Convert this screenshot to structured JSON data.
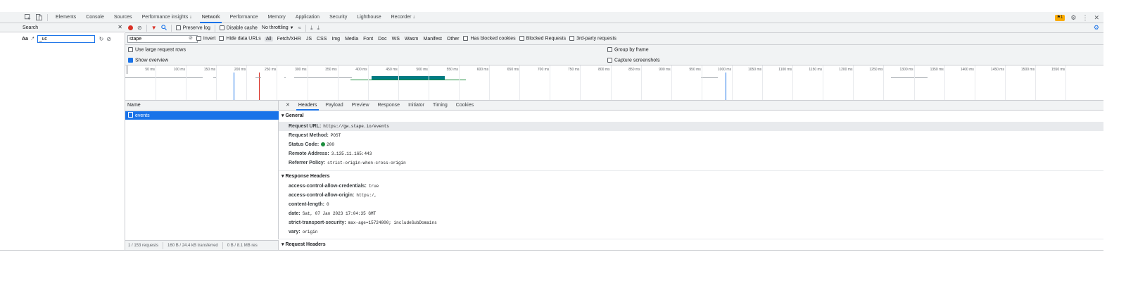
{
  "topbar": {
    "tabs": [
      "Elements",
      "Console",
      "Sources",
      "Performance insights ↓",
      "Network",
      "Performance",
      "Memory",
      "Application",
      "Security",
      "Lighthouse",
      "Recorder ↓"
    ],
    "active_tab": "Network",
    "issues_count": "1"
  },
  "search": {
    "title": "Search",
    "case_label": "Aa",
    "regex_label": ".*",
    "query": "_uc"
  },
  "toolbar": {
    "preserve_log": "Preserve log",
    "disable_cache": "Disable cache",
    "throttling": "No throttling"
  },
  "filter": {
    "value": "stape",
    "invert": "Invert",
    "hide_data_urls": "Hide data URLs",
    "types": [
      "All",
      "Fetch/XHR",
      "JS",
      "CSS",
      "Img",
      "Media",
      "Font",
      "Doc",
      "WS",
      "Wasm",
      "Manifest",
      "Other"
    ],
    "active_type": "All",
    "has_blocked_cookies": "Has blocked cookies",
    "blocked_requests": "Blocked Requests",
    "third_party": "3rd-party requests"
  },
  "settings": {
    "large_rows": "Use large request rows",
    "show_overview": "Show overview",
    "group_by_frame": "Group by frame",
    "capture_screenshots": "Capture screenshots"
  },
  "overview": {
    "ticks": [
      "50 ms",
      "100 ms",
      "150 ms",
      "200 ms",
      "250 ms",
      "300 ms",
      "350 ms",
      "400 ms",
      "450 ms",
      "500 ms",
      "550 ms",
      "600 ms",
      "650 ms",
      "700 ms",
      "750 ms",
      "800 ms",
      "850 ms",
      "900 ms",
      "950 ms",
      "1000 ms",
      "1050 ms",
      "1100 ms",
      "1150 ms",
      "1200 ms",
      "1250 ms",
      "1300 ms",
      "1350 ms",
      "1400 ms",
      "1450 ms",
      "1500 ms",
      "1550 ms"
    ]
  },
  "requests": {
    "name_header": "Name",
    "items": [
      "events"
    ],
    "summary_requests": "1 / 153 requests",
    "summary_transferred": "160 B / 24.4 kB transferred",
    "summary_resources": "0 B / 8.1 MB res"
  },
  "details": {
    "tabs": [
      "Headers",
      "Payload",
      "Preview",
      "Response",
      "Initiator",
      "Timing",
      "Cookies"
    ],
    "active_tab": "Headers",
    "general_title": "▾ General",
    "general": [
      {
        "key": "Request URL:",
        "value": "https://gw.stape.io/events"
      },
      {
        "key": "Request Method:",
        "value": "POST"
      },
      {
        "key": "Status Code:",
        "value": "200"
      },
      {
        "key": "Remote Address:",
        "value": "3.135.11.165:443"
      },
      {
        "key": "Referrer Policy:",
        "value": "strict-origin-when-cross-origin"
      }
    ],
    "response_title": "▾ Response Headers",
    "response": [
      {
        "key": "access-control-allow-credentials:",
        "value": "true"
      },
      {
        "key": "access-control-allow-origin:",
        "value": "https:/,"
      },
      {
        "key": "content-length:",
        "value": "0"
      },
      {
        "key": "date:",
        "value": "Sat, 07 Jan 2023 17:04:35 GMT"
      },
      {
        "key": "strict-transport-security:",
        "value": "max-age=15724800; includeSubDomains"
      },
      {
        "key": "vary:",
        "value": "origin"
      }
    ],
    "request_title": "▾ Request Headers"
  }
}
